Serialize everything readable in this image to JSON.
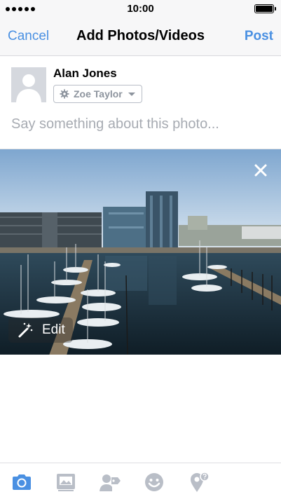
{
  "status_bar": {
    "time": "10:00"
  },
  "nav": {
    "cancel_label": "Cancel",
    "title": "Add Photos/Videos",
    "post_label": "Post"
  },
  "composer": {
    "user_name": "Alan Jones",
    "audience_label": "Zoe Taylor",
    "placeholder": "Say something about this photo..."
  },
  "photo": {
    "edit_label": "Edit"
  },
  "toolbar": {
    "items": [
      {
        "icon": "camera-icon",
        "active": true
      },
      {
        "icon": "photo-album-icon",
        "active": false
      },
      {
        "icon": "tag-people-icon",
        "active": false
      },
      {
        "icon": "feeling-icon",
        "active": false
      },
      {
        "icon": "location-icon",
        "active": false
      }
    ]
  },
  "colors": {
    "accent": "#4a90e2",
    "inactive_icon": "#b9bec7",
    "placeholder": "#a7abb2"
  }
}
